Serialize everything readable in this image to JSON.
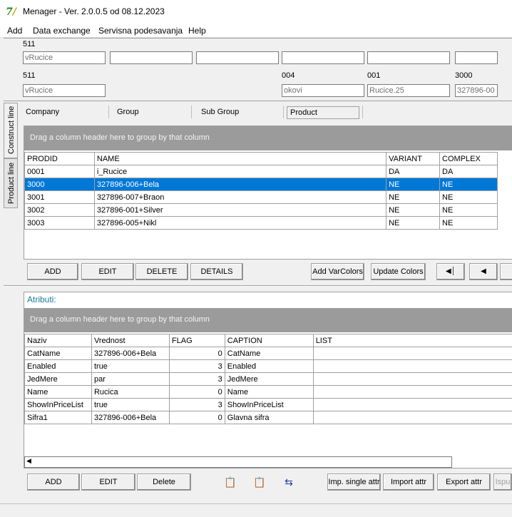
{
  "window": {
    "title": "Menager - Ver. 2.0.0.5 od 08.12.2023"
  },
  "menu": [
    "Add",
    "Data exchange",
    "Servisna podesavanja",
    "Help"
  ],
  "row1": {
    "code": "511",
    "fields": [
      "vRucice",
      "",
      "",
      "",
      "",
      ""
    ]
  },
  "row2": {
    "codes": [
      "511",
      "004",
      "001",
      "3000"
    ],
    "fields": [
      "vRucice",
      "okovi",
      "Rucice.25",
      "327896-00"
    ]
  },
  "side_tabs": [
    "Construct line",
    "Product line"
  ],
  "tabs": [
    "Company",
    "Group",
    "Sub Group",
    "Product"
  ],
  "products": {
    "group_hint": "Drag a column header here to group by that column",
    "columns": [
      "PRODID",
      "NAME",
      "VARIANT",
      "COMPLEX"
    ],
    "rows": [
      [
        "0001",
        "i_Rucice",
        "DA",
        "DA"
      ],
      [
        "3000",
        "327896-006+Bela",
        "NE",
        "NE"
      ],
      [
        "3001",
        "327896-007+Braon",
        "NE",
        "NE"
      ],
      [
        "3002",
        "327896-001+Silver",
        "NE",
        "NE"
      ],
      [
        "3003",
        "327896-005+Nikl",
        "NE",
        "NE"
      ]
    ],
    "selected_row": 1,
    "buttons": [
      "ADD",
      "EDIT",
      "DELETE",
      "DETAILS",
      "Add VarColors",
      "Update Colors"
    ],
    "nav": [
      "first-icon",
      "prev-icon"
    ]
  },
  "attributes": {
    "label": "Atributi:",
    "group_hint": "Drag a column header here to group by that column",
    "columns": [
      "Naziv",
      "Vrednost",
      "FLAG",
      "CAPTION",
      "LIST"
    ],
    "rows": [
      [
        "CatName",
        "327896-006+Bela",
        "0",
        "CatName",
        ""
      ],
      [
        "Enabled",
        "true",
        "3",
        "Enabled",
        ""
      ],
      [
        "JedMere",
        "par",
        "3",
        "JedMere",
        ""
      ],
      [
        "Name",
        "Rucica",
        "0",
        "Name",
        ""
      ],
      [
        "ShowInPriceList",
        "true",
        "3",
        "ShowInPriceList",
        ""
      ],
      [
        "Sifra1",
        "327896-006+Bela",
        "0",
        "Glavna sifra",
        ""
      ]
    ],
    "buttons": [
      "ADD",
      "EDIT",
      "Delete",
      "Imp. single attr",
      "Import attr",
      "Export attr",
      "Ispu"
    ]
  },
  "colors": {
    "selection": "#0078d7",
    "group_bar": "#9b9b9b",
    "section_label": "#1a7a9a"
  }
}
